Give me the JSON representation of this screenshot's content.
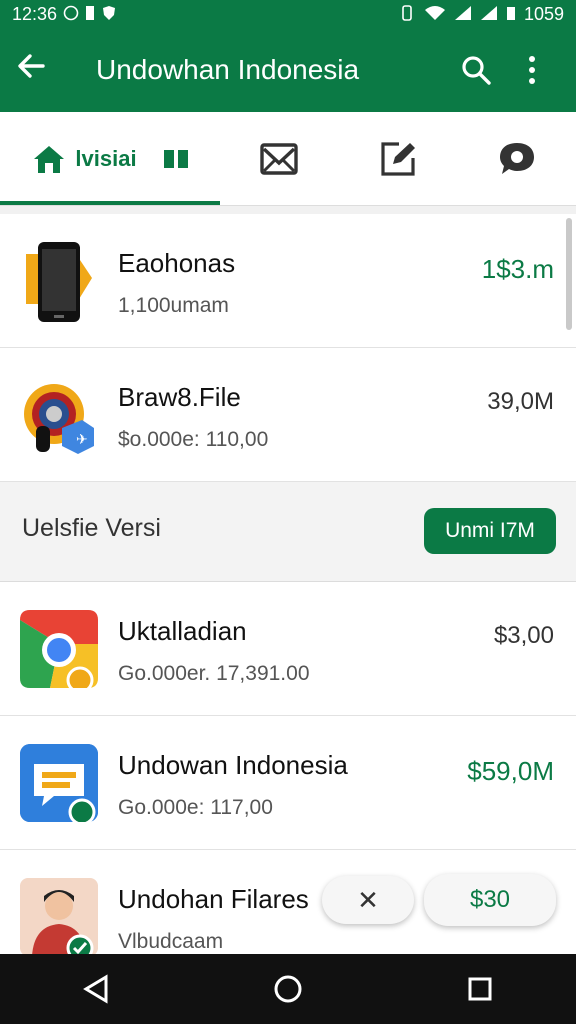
{
  "status": {
    "time": "12:36",
    "right_text": "1059",
    "colors": {
      "bar": "#0b7a45"
    }
  },
  "app_bar": {
    "title": "Undowhan Indonesia",
    "back_icon": "arrow-left-icon",
    "search_icon": "search-icon",
    "menu_icon": "more-vert-icon"
  },
  "tabs": {
    "home_label": "lvisiai",
    "icons": [
      "home-icon",
      "bar-chart-icon",
      "mail-icon",
      "edit-icon",
      "chat-icon"
    ]
  },
  "items_top": [
    {
      "name": "Eaohonas",
      "sub": "1,100umam",
      "price": "1$3.m",
      "price_color": "green",
      "icon": "phone-icon"
    },
    {
      "name": "Braw8.File",
      "sub": "$o.000e: 110,00",
      "price": "39,0M",
      "price_color": "gray",
      "icon": "gear-badge-icon"
    }
  ],
  "section": {
    "label": "Uelsfie Versi",
    "button": "Unmi I7M"
  },
  "items_bottom": [
    {
      "name": "Uktalladian",
      "sub": "Go.000er. 17,391.00",
      "price": "$3,00",
      "price_color": "gray",
      "icon": "chrome-icon"
    },
    {
      "name": "Undowan Indonesia",
      "sub": "Go.000e: 117,00",
      "price": "$59,0M",
      "price_color": "green",
      "icon": "chat-bubble-icon"
    },
    {
      "name": "Undohan Filares",
      "sub": "Vlbudcaam",
      "price": "",
      "price_color": "gray",
      "icon": "person-avatar-icon"
    }
  ],
  "chips": {
    "chip1_symbol": "✕",
    "chip2_label": "$30"
  },
  "nav": {
    "back": "nav-back-icon",
    "home": "nav-home-icon",
    "recents": "nav-recents-icon"
  }
}
